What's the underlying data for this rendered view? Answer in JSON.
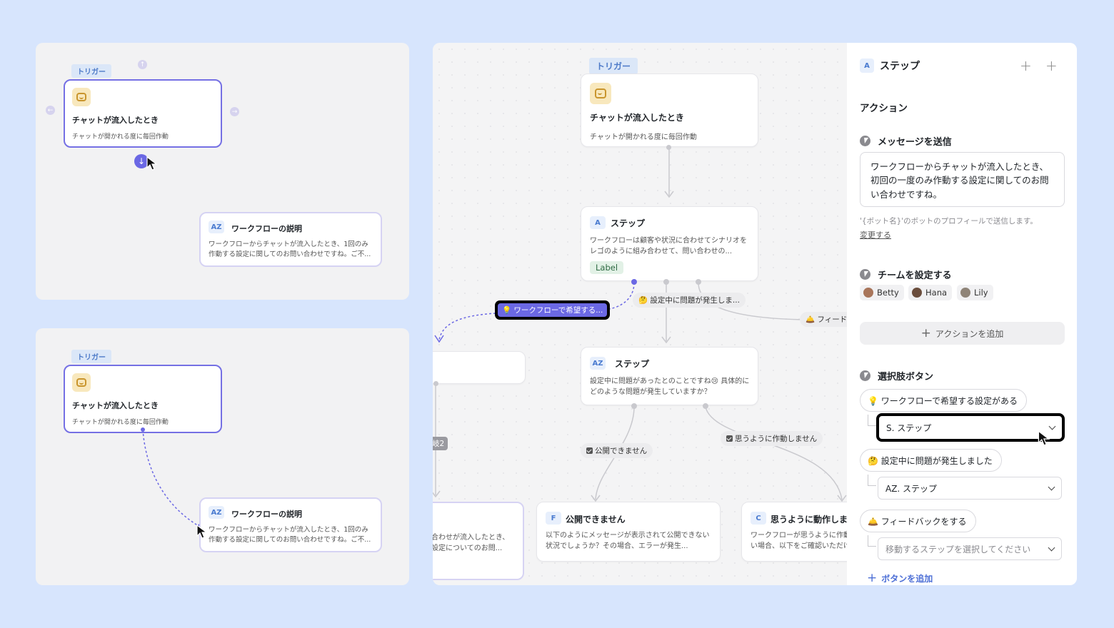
{
  "colors": {
    "background": "#d7e5fd",
    "accent": "#6b68e4",
    "link": "#4d6fd6"
  },
  "panel1": {
    "trigger_tag": "トリガー",
    "trigger_title": "チャットが流入したとき",
    "trigger_sub": "チャットが開かれる度に毎回作動",
    "desc_badge": "AZ",
    "desc_title": "ワークフローの説明",
    "desc_text": "ワークフローからチャットが流入したとき、1回のみ作動する設定に関してのお問い合わせですね。ご不..."
  },
  "panel2": {
    "trigger_tag": "トリガー",
    "trigger_title": "チャットが流入したとき",
    "trigger_sub": "チャットが開かれる度に毎回作動",
    "desc_badge": "AZ",
    "desc_title": "ワークフローの説明",
    "desc_text": "ワークフローからチャットが流入したとき、1回のみ作動する設定に関してのお問い合わせですね。ご不..."
  },
  "canvas": {
    "trigger_tag": "トリガー",
    "trigger_title": "チャットが流入したとき",
    "trigger_sub": "チャットが開かれる度に毎回作動",
    "stepA": {
      "badge": "A",
      "title": "ステップ",
      "desc": "ワークフローは顧客や状況に合わせてシナリオをレゴのように組み合わせて、問い合わせの...",
      "label": "Label"
    },
    "highlight_label": "💡 ワークフローで希望する...",
    "edge_problem": "🤔 設定中に問題が発生しま...",
    "edge_feedback": "🛎️ フィードバ",
    "stepAZ": {
      "badge": "AZ",
      "title": "ステップ",
      "desc": "設定中に問題があったとのことですね😢 具体的にどのような問題が発生していますか？"
    },
    "edge_branch": "岐2",
    "edge_publish": "公開できません",
    "edge_notwork": "思うように作動しません",
    "stepF": {
      "badge": "F",
      "title": "公開できません",
      "desc": "以下のようにメッセージが表示されて公開できない状況でしょうか？その場合、エラーが発生..."
    },
    "stepC": {
      "badge": "C",
      "title": "思うように動作しま",
      "desc": "ワークフローが思うように作動しない場合、以下をご確認いただけま"
    },
    "left_node_desc": "合わせが流入したとき、設定についてのお問..."
  },
  "sidebar": {
    "badge": "A",
    "title": "ステップ",
    "section_action": "アクション",
    "send_message_title": "メッセージを送信",
    "message_text": "ワークフローからチャットが流入したとき、初回の一度のみ作動する設定に関してのお問い合わせですね。",
    "bot_hint": "'{ボット名}'のボットのプロフィールで送信します。",
    "change_link": "変更する",
    "team_title": "チームを設定する",
    "team_members": [
      "Betty",
      "Hana",
      "Lily"
    ],
    "add_action": "アクションを追加",
    "choice_title": "選択肢ボタン",
    "choices": [
      {
        "label": "💡 ワークフローで希望する設定がある",
        "target": "S. ステップ"
      },
      {
        "label": "🤔 設定中に問題が発生しました",
        "target": "AZ. ステップ"
      },
      {
        "label": "🛎️ フィードバックをする",
        "target": "移動するステップを選択してください"
      }
    ],
    "add_button": "ボタンを追加"
  }
}
